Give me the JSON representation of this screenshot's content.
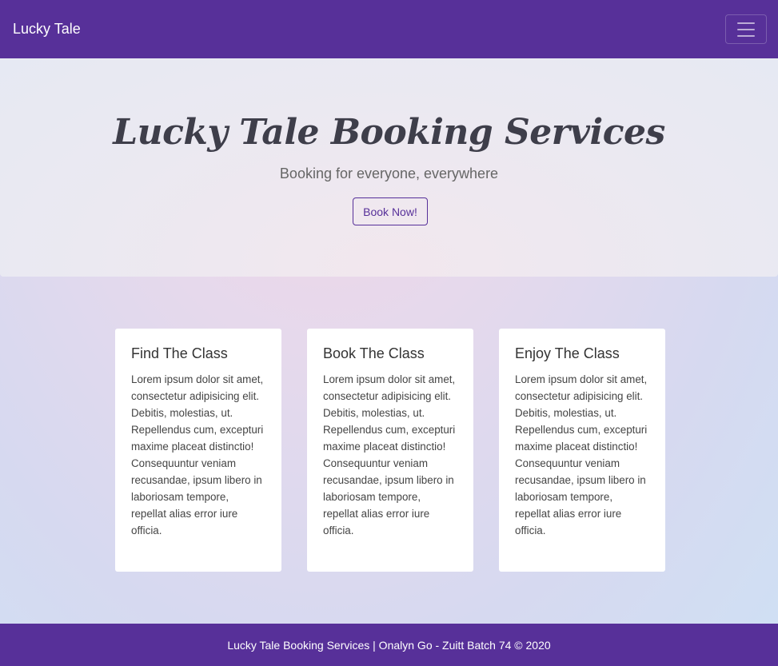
{
  "navbar": {
    "brand": "Lucky Tale",
    "toggler_icon": "hamburger-menu-icon"
  },
  "hero": {
    "title": "Lucky Tale Booking Services",
    "subtitle": "Booking for everyone, everywhere",
    "button_label": "Book Now!"
  },
  "cards": [
    {
      "title": "Find The Class",
      "text": "Lorem ipsum dolor sit amet, consectetur adipisicing elit. Debitis, molestias, ut. Repellendus cum, excepturi maxime placeat distinctio! Consequuntur veniam recusandae, ipsum libero in laboriosam tempore, repellat alias error iure officia."
    },
    {
      "title": "Book The Class",
      "text": "Lorem ipsum dolor sit amet, consectetur adipisicing elit. Debitis, molestias, ut. Repellendus cum, excepturi maxime placeat distinctio! Consequuntur veniam recusandae, ipsum libero in laboriosam tempore, repellat alias error iure officia."
    },
    {
      "title": "Enjoy The Class",
      "text": "Lorem ipsum dolor sit amet, consectetur adipisicing elit. Debitis, molestias, ut. Repellendus cum, excepturi maxime placeat distinctio! Consequuntur veniam recusandae, ipsum libero in laboriosam tempore, repellat alias error iure officia."
    }
  ],
  "footer": {
    "text": "Lucky Tale Booking Services | Onalyn Go - Zuitt Batch 74 © 2020"
  },
  "colors": {
    "brand_purple": "#573099",
    "card_bg": "#ffffff"
  }
}
